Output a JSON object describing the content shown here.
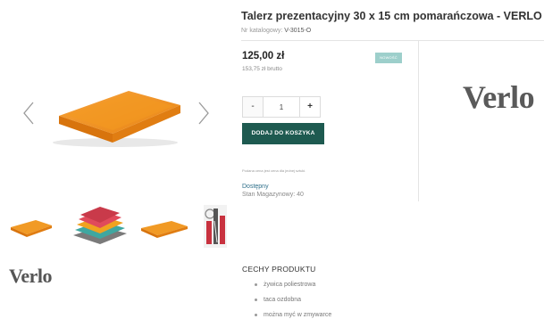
{
  "product": {
    "title": "Talerz prezentacyjny 30 x 15 cm pomarańczowa - VERLO",
    "catalog_label": "Nr katalogowy:",
    "catalog_number": "V-3015-O",
    "price": "125,00 zł",
    "price_gross": "153,75 zł brutto",
    "badge": "NOWOŚĆ",
    "brand": "Verlo"
  },
  "purchase": {
    "minus_label": "-",
    "quantity": "1",
    "plus_label": "+",
    "add_to_cart_label": "DODAJ DO KOSZYKA",
    "price_note": "Podana cena jest cena dla jednej sztuki.",
    "availability": "Dostępny",
    "stock": "Stan Magazynowy: 40"
  },
  "gallery": {
    "thumbnails": [
      "orange-board",
      "colored-boards-stack",
      "orange-board",
      "kitchen-tools"
    ]
  },
  "features": {
    "title": "CECHY PRODUKTU",
    "items": [
      "żywica poliestrowa",
      "taca ozdobna",
      "można myć w zmywarce"
    ]
  },
  "colors": {
    "accent": "#1e5a50",
    "badge": "#9dcfcb",
    "product_orange": "#f08a1a",
    "link": "#2e6f8a"
  }
}
